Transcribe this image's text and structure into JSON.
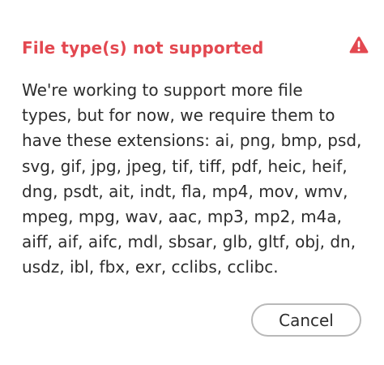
{
  "dialog": {
    "title": "File type(s) not supported",
    "alert_icon": "alert-triangle-icon",
    "message_lines": [
      "We're working to support more file",
      "types, but for now, we require them to",
      "have these extensions: ai, png, bmp, psd,",
      "svg, gif, jpg, jpeg, tif, tiff, pdf, heic, heif,",
      "dng, psdt, ait, indt, fla, mp4, mov, wmv,",
      "mpeg, mpg, wav, aac, mp3, mp2, m4a,",
      "aiff, aif, aifc, mdl, sbsar, glb, gltf, obj, dn,",
      "usdz, ibl, fbx, exr, cclibs, cclibc."
    ],
    "cancel_label": "Cancel"
  },
  "colors": {
    "title": "#e34850",
    "icon": "#e34850",
    "text": "#2c2c2c",
    "button_border": "#b9b9b9",
    "background": "#ffffff"
  }
}
